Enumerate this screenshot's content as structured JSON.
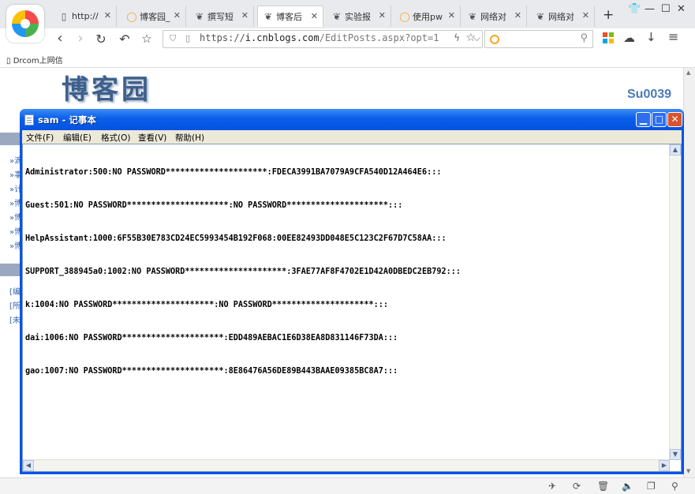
{
  "browser": {
    "tabs": [
      {
        "label": "http://",
        "icon": "page-icon"
      },
      {
        "label": "博客园_",
        "icon": "browser-circle-icon"
      },
      {
        "label": "撰写短",
        "icon": "cnblogs-icon"
      },
      {
        "label": "博客后",
        "icon": "cnblogs-icon"
      },
      {
        "label": "实验报",
        "icon": "cnblogs-icon"
      },
      {
        "label": "使用pw",
        "icon": "browser-circle-icon"
      },
      {
        "label": "网络对",
        "icon": "cnblogs-icon"
      },
      {
        "label": "网络对",
        "icon": "cnblogs-icon"
      }
    ],
    "new_tab": "+",
    "address": {
      "scheme": "https://",
      "host": "i.cnblogs.com",
      "path": "/EditPosts.aspx?opt=1"
    },
    "bookmarks": [
      "Drcom上网信"
    ]
  },
  "webpage": {
    "logo_text": "博客园",
    "username": "Su0039",
    "left_links": [
      "»滴",
      "»事",
      "»计",
      "»博",
      "»博",
      "»博",
      "»博"
    ],
    "left_links2": [
      "[编",
      "[所",
      "[未"
    ]
  },
  "notepad": {
    "title": "sam - 记事本",
    "menus": [
      "文件(F)",
      "编辑(E)",
      "格式(O)",
      "查看(V)",
      "帮助(H)"
    ],
    "lines": [
      "Administrator:500:NO PASSWORD*********************:FDECA3991BA7079A9CFA540D12A464E6:::",
      "Guest:501:NO PASSWORD*********************:NO PASSWORD*********************:::",
      "HelpAssistant:1000:6F55B30E783CD24EC5993454B192F068:00EE82493DD048E5C123C2F67D7C58AA:::",
      "SUPPORT_388945a0:1002:NO PASSWORD*********************:3FAE77AF8F4702E1D42A0DBEDC2EB792:::",
      "k:1004:NO PASSWORD*********************:NO PASSWORD*********************:::",
      "dai:1006:NO PASSWORD*********************:EDD489AEBAC1E6D38EA8D831146F73DA:::",
      "gao:1007:NO PASSWORD*********************:8E86476A56DE89B443BAAE09385BC8A7:::"
    ]
  },
  "colors": {
    "titlebar": "#0a5fe8",
    "close": "#d9532c",
    "menubar": "#ece9d8",
    "site_blue": "#4a7bb8"
  }
}
